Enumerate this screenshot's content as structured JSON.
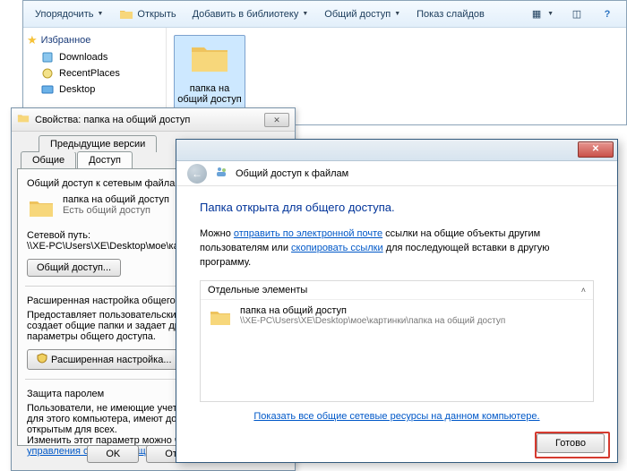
{
  "explorer": {
    "toolbar": {
      "organize": "Упорядочить",
      "open": "Открыть",
      "add_library": "Добавить в библиотеку",
      "share": "Общий доступ",
      "slideshow": "Показ слайдов"
    },
    "favorites": {
      "header": "Избранное",
      "items": [
        "Downloads",
        "RecentPlaces",
        "Desktop"
      ]
    },
    "folder_name": "папка на общий доступ"
  },
  "properties": {
    "title": "Свойства: папка на общий доступ",
    "tabs": {
      "prev_versions": "Предыдущие версии",
      "general": "Общие",
      "access": "Доступ"
    },
    "group_header": "Общий доступ к сетевым файлам и папкам",
    "folder_name": "папка на общий доступ",
    "status": "Есть общий доступ",
    "netpath_label": "Сетевой путь:",
    "netpath_value": "\\\\XE-PC\\Users\\XE\\Desktop\\мое\\картинки",
    "share_btn": "Общий доступ...",
    "adv_header": "Расширенная настройка общего доступа",
    "adv_text": "Предоставляет пользовательские разрешения, создает общие папки и задает другие дополнительные параметры общего доступа.",
    "adv_btn": "Расширенная настройка...",
    "pw_header": "Защита паролем",
    "pw_text1": "Пользователи, не имеющие учетной записи и пароля для этого компьютера, имеют доступ к папкам, открытым для всех.",
    "pw_text2": "Изменить этот параметр можно через",
    "pw_link": "Центр управления сетями и общим доступом.",
    "ok": "OK",
    "cancel": "Отмена"
  },
  "wizard": {
    "nav_title": "Общий доступ к файлам",
    "heading": "Папка открыта для общего доступа.",
    "body_pre": "Можно ",
    "link_email": "отправить по электронной почте",
    "body_mid": " ссылки на общие объекты другим пользователям или ",
    "link_copy": "скопировать ссылки",
    "body_post": " для последующей вставки в другую программу.",
    "items_header": "Отдельные элементы",
    "item_name": "папка на общий доступ",
    "item_path": "\\\\XE-PC\\Users\\XE\\Desktop\\мое\\картинки\\папка на общий доступ",
    "all_resources_link": "Показать все общие сетевые ресурсы на данном компьютере.",
    "ready": "Готово"
  }
}
